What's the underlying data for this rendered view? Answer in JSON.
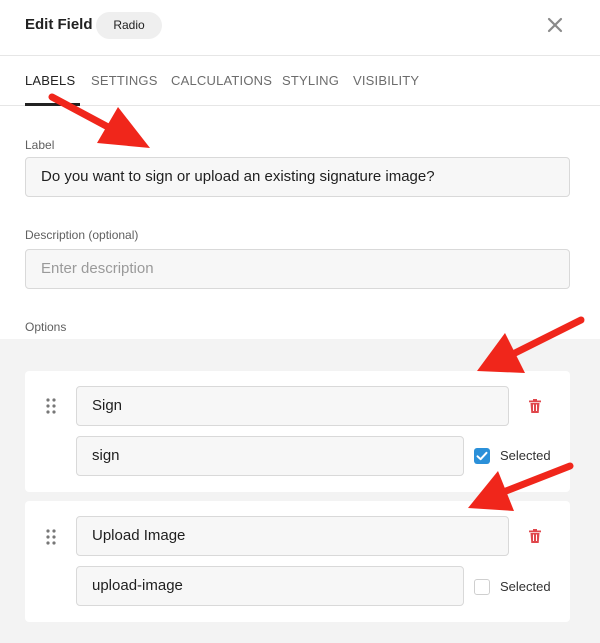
{
  "header": {
    "title": "Edit Field",
    "field_type": "Radio",
    "close_icon": "close-icon"
  },
  "tabs": [
    {
      "label": "LABELS",
      "active": true
    },
    {
      "label": "SETTINGS",
      "active": false
    },
    {
      "label": "CALCULATIONS",
      "active": false
    },
    {
      "label": "STYLING",
      "active": false
    },
    {
      "label": "VISIBILITY",
      "active": false
    }
  ],
  "form": {
    "label_caption": "Label",
    "label_value": "Do you want to sign or upload an existing signature image?",
    "description_caption": "Description (optional)",
    "description_placeholder": "Enter description",
    "options_caption": "Options"
  },
  "options": [
    {
      "label": "Sign",
      "value": "sign",
      "selected": true,
      "selected_label": "Selected"
    },
    {
      "label": "Upload Image",
      "value": "upload-image",
      "selected": false,
      "selected_label": "Selected"
    }
  ],
  "colors": {
    "accent": "#2b90d9",
    "trash": "#e0474c",
    "annotation_arrow": "#f0261b"
  }
}
